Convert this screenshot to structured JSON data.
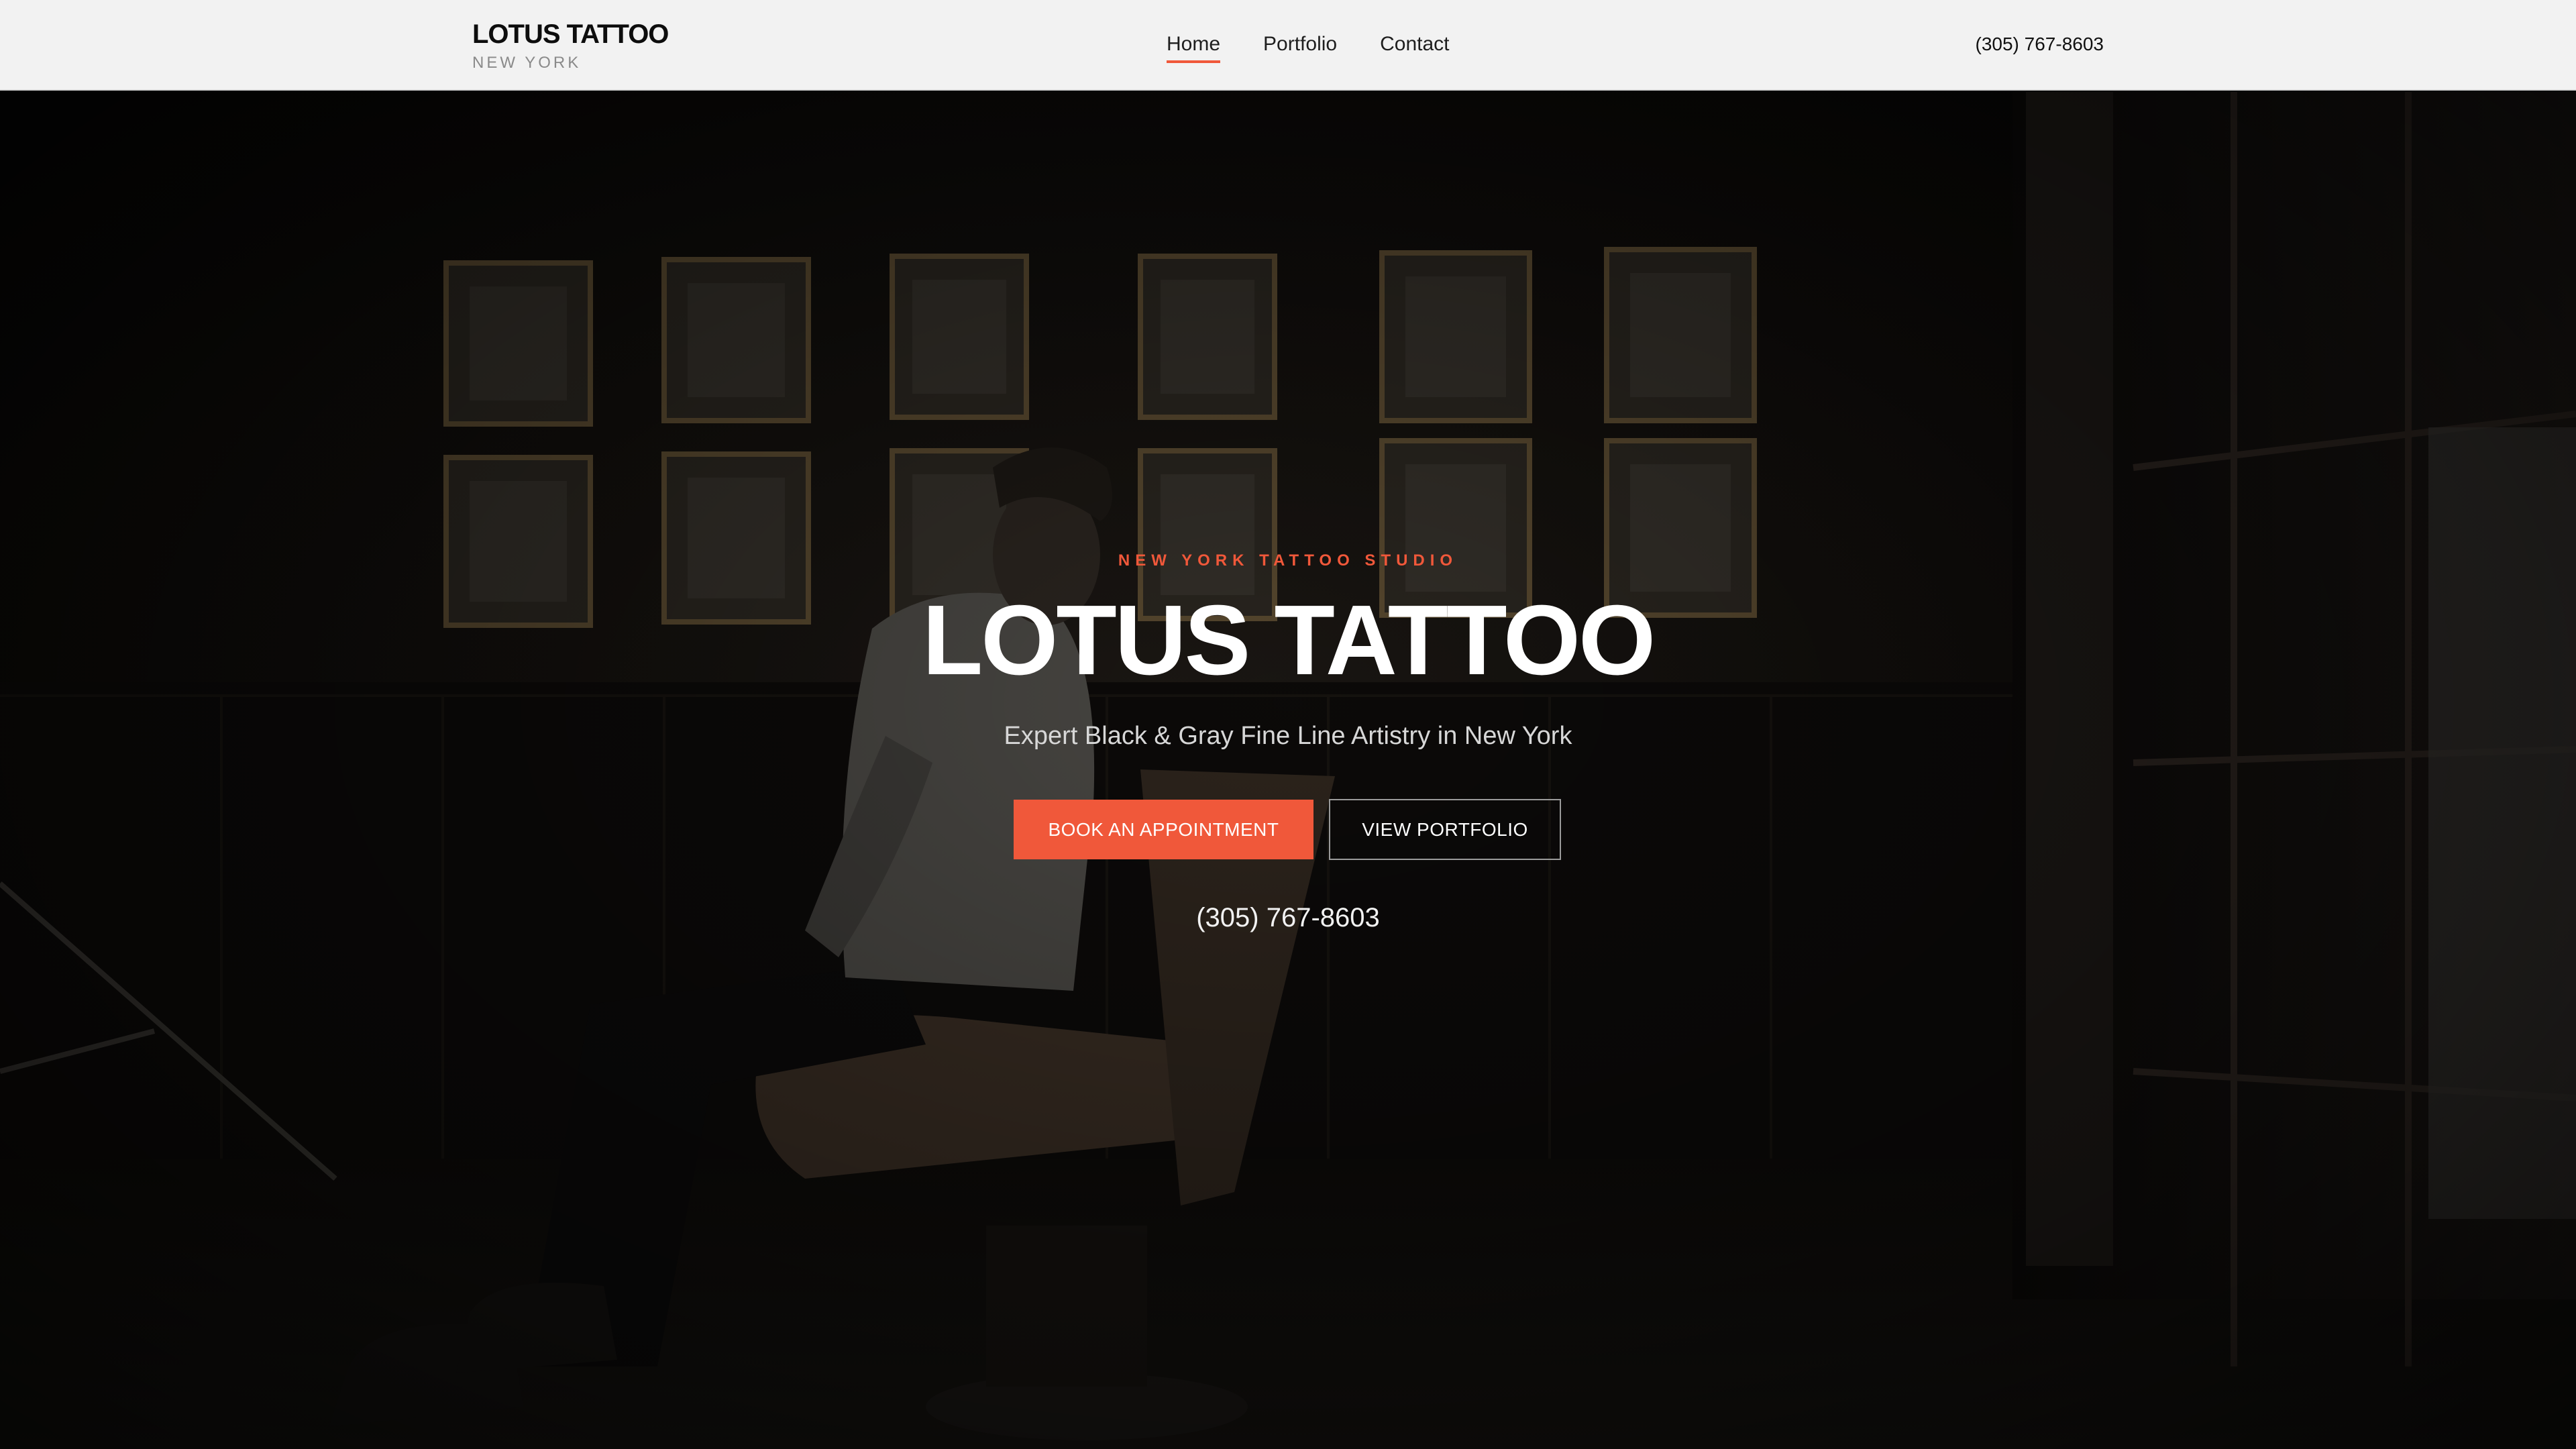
{
  "header": {
    "brand_name": "LOTUS TATTOO",
    "brand_sub": "NEW YORK",
    "nav": [
      {
        "label": "Home",
        "active": true
      },
      {
        "label": "Portfolio",
        "active": false
      },
      {
        "label": "Contact",
        "active": false
      }
    ],
    "phone": "(305) 767-8603"
  },
  "hero": {
    "eyebrow": "NEW YORK TATTOO STUDIO",
    "title": "LOTUS TATTOO",
    "subtitle": "Expert Black & Gray Fine Line Artistry in New York",
    "primary_button": "BOOK AN APPOINTMENT",
    "secondary_button": "VIEW PORTFOLIO",
    "phone": "(305) 767-8603",
    "background_image": "dimly-lit-tattoo-studio-man-in-chair"
  },
  "colors": {
    "accent": "#f0583a",
    "header_bg": "#f2f2f2",
    "hero_bg": "#070605",
    "text_light": "#ffffff"
  }
}
